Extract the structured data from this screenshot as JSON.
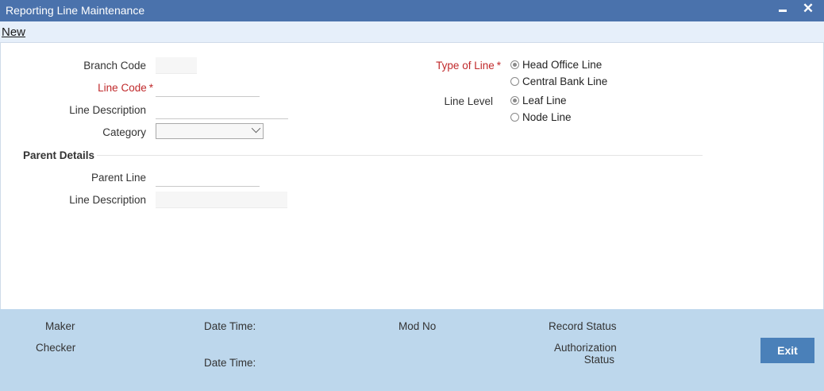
{
  "window": {
    "title": "Reporting Line Maintenance",
    "minimize_icon": "minimize-icon",
    "close_icon": "close-icon",
    "close_glyph": "✕"
  },
  "toolbar": {
    "new_label": "New"
  },
  "form": {
    "branch_code": {
      "label": "Branch Code",
      "value": ""
    },
    "line_code": {
      "label": "Line Code",
      "required_mark": "*",
      "value": ""
    },
    "line_description": {
      "label": "Line Description",
      "value": ""
    },
    "category": {
      "label": "Category",
      "value": ""
    },
    "type_of_line": {
      "label": "Type of Line",
      "required_mark": "*",
      "options": [
        "Head Office Line",
        "Central Bank Line"
      ],
      "selected": "Head Office Line"
    },
    "line_level": {
      "label": "Line Level",
      "options": [
        "Leaf Line",
        "Node Line"
      ],
      "selected": "Leaf Line"
    }
  },
  "parent_details": {
    "title": "Parent Details",
    "parent_line": {
      "label": "Parent Line",
      "value": ""
    },
    "line_description": {
      "label": "Line Description",
      "value": ""
    }
  },
  "footer": {
    "maker": "Maker",
    "checker": "Checker",
    "date_time_1": "Date Time:",
    "date_time_2": "Date Time:",
    "mod_no": "Mod No",
    "record_status": "Record Status",
    "authorization_status_line1": "Authorization",
    "authorization_status_line2": "Status",
    "exit_label": "Exit"
  },
  "colors": {
    "title_bar": "#4a72ac",
    "required": "#c0292b",
    "footer": "#bdd7ec",
    "exit_button": "#4a80b9"
  }
}
